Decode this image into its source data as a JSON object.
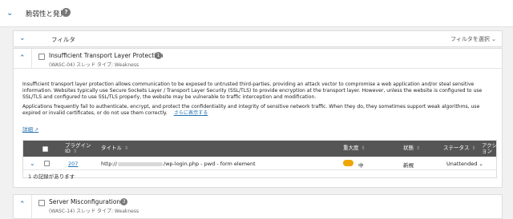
{
  "section": {
    "title": "脆弱性と発見",
    "help_badge": "?"
  },
  "filter": {
    "label": "フィルタ",
    "select_label": "フィルタを選択"
  },
  "vuln1": {
    "name": "Insufficient Transport Layer Protection",
    "count": "1",
    "meta": "(WASC-04) スレッド タイプ: Weakness",
    "desc_p1": "Insufficient transport layer protection allows communication to be exposed to untrusted third-parties, providing an attack vector to compromise a web application and/or steal sensitive information. Websites typically use Secure Sockets Layer / Transport Layer Security (SSL/TLS) to provide encryption at the transport layer. However, unless the website is configured to use SSL/TLS and configured to use SSL/TLS properly, the website may be vulnerable to traffic interception and modification.",
    "desc_p2": "Applications frequently fail to authenticate, encrypt, and protect the confidentiality and integrity of sensitive network traffic. When they do, they sometimes support weak algorithms, use expired or invalid certificates, or do not use them correctly.",
    "show_more": "さらに表示する",
    "details": "詳細",
    "record_count": "1 の記録があります"
  },
  "table": {
    "headers": {
      "plugin_id": "プラグイン ID",
      "title": "タイトル",
      "severity": "重大度",
      "status": "状態",
      "state": "ステータス",
      "action": "アクション"
    },
    "row": {
      "plugin_id": "207",
      "title_prefix": "http://",
      "title_suffix": "/wp-login.php - pwd - form element",
      "severity": "中",
      "severity_color": "#f0a500",
      "status": "新規",
      "state": "Unattended"
    }
  },
  "vuln2": {
    "name": "Server Misconfiguration",
    "count": "3",
    "meta": "(WASC-14) スレッド タイプ: Weakness"
  }
}
